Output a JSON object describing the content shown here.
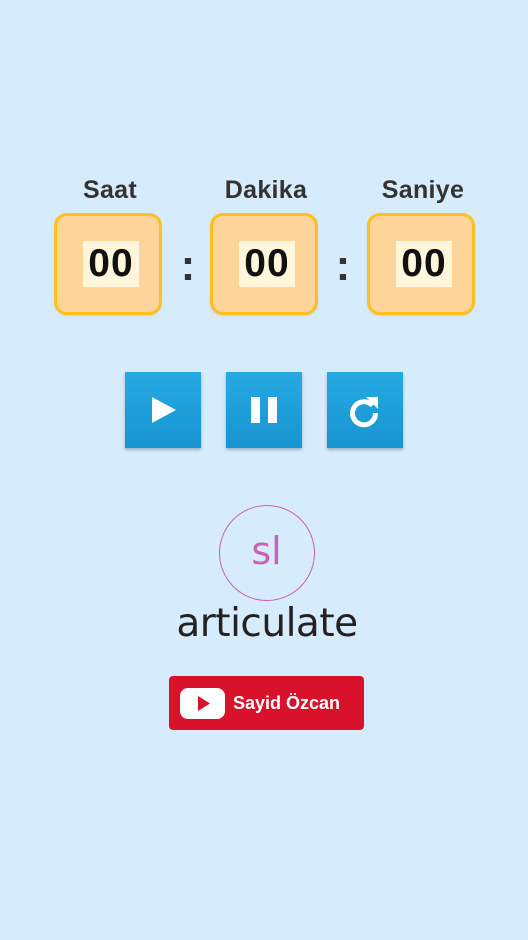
{
  "timer": {
    "units": [
      {
        "label": "Saat",
        "value": "00"
      },
      {
        "label": "Dakika",
        "value": "00"
      },
      {
        "label": "Saniye",
        "value": "00"
      }
    ],
    "separator": ":"
  },
  "controls": [
    {
      "name": "play",
      "icon": "play-icon"
    },
    {
      "name": "pause",
      "icon": "pause-icon"
    },
    {
      "name": "reset",
      "icon": "reset-icon"
    }
  ],
  "branding": {
    "badge_text": "sl",
    "wordmark": "articulate",
    "badge_color": "#c961b4"
  },
  "youtube_button": {
    "label": "Sayid Özcan",
    "icon": "youtube-play-icon",
    "color": "#d9122c"
  },
  "colors": {
    "background": "#d6ebfb",
    "box_fill": "#ffd49a",
    "box_border": "#ffc01e",
    "button_blue": "#1795d1"
  }
}
